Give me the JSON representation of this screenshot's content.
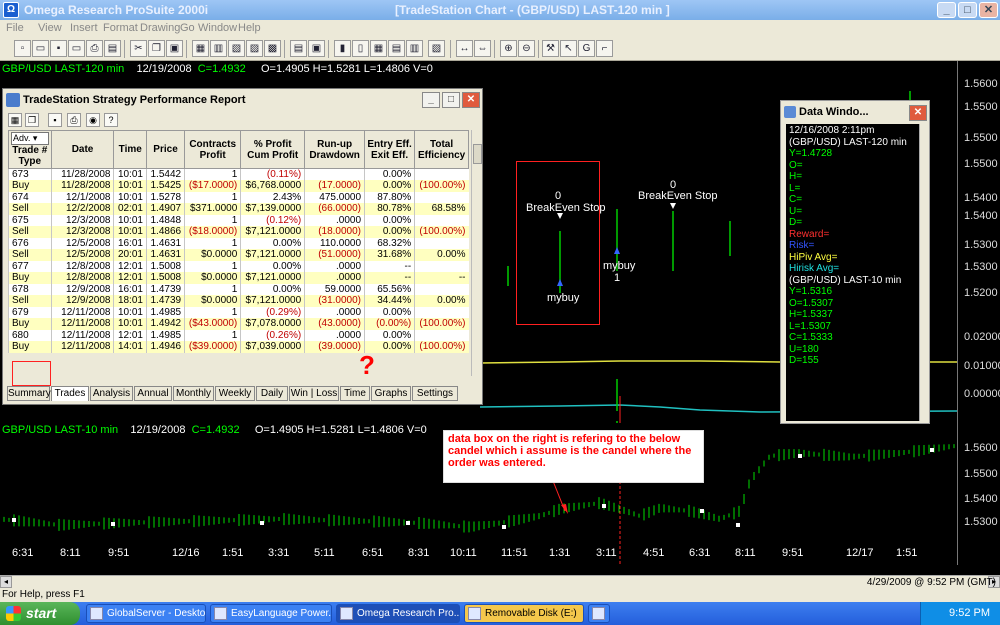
{
  "window": {
    "app_title": "Omega Research ProSuite 2000i",
    "chart_title": "[TradeStation Chart - (GBP/USD)  LAST-120 min ]",
    "minimize": "_",
    "maximize": "□",
    "close": "✕"
  },
  "menu": [
    "File",
    "View",
    "Insert",
    "Format",
    "Drawing",
    "Go",
    "Window",
    "Help"
  ],
  "chart": {
    "upper_header": {
      "symbol": "GBP/USD LAST-120 min",
      "date": "12/19/2008",
      "close": "C=1.4932",
      "ohlcv": "O=1.4905  H=1.5281  L=1.4806  V=0"
    },
    "lower_header": {
      "symbol": "GBP/USD LAST-10 min",
      "date": "12/19/2008",
      "close": "C=1.4932",
      "ohlcv": "O=1.4905  H=1.5281  L=1.4806  V=0"
    },
    "price_labels_upper": [
      "1.5600",
      "1.5500",
      "1.5400",
      "1.5300",
      "1.5200"
    ],
    "price_labels_mid": [
      "0.02000",
      "0.01000",
      "0.00000"
    ],
    "price_labels_lower": [
      "1.5600",
      "1.5500",
      "1.5400",
      "1.5300"
    ],
    "time_labels": [
      "6:31",
      "8:11",
      "9:51",
      "12/16",
      "1:51",
      "3:31",
      "5:11",
      "6:51",
      "8:31",
      "10:11",
      "11:51",
      "1:31",
      "3:11",
      "4:51",
      "6:31",
      "8:11",
      "9:51",
      "12/17",
      "1:51"
    ],
    "orders": [
      {
        "count": "0",
        "label": "BreakEven Stop"
      },
      {
        "count": "0",
        "label": "BreakEven Stop"
      }
    ],
    "mybuy_1": "mybuy",
    "mybuy_2": "mybuy",
    "mybuy_2_count": "1",
    "annotation": "data box on the right is refering to the below candel which i assume is the candel where the order was entered.",
    "question_mark": "?"
  },
  "colors": {
    "up": "#00ff00",
    "green_bar": "#00cc00",
    "blue": "#3366ff",
    "yellow_line": "#e0e040",
    "cyan_line": "#20c0c0",
    "red_line": "#ff2020"
  },
  "perf_report": {
    "title": "TradeStation Strategy Performance Report",
    "selector": "Adv.",
    "headers": [
      "Trade #\nType",
      "Date",
      "Time",
      "Price",
      "Contracts\nProfit",
      "% Profit\nCum Profit",
      "Run-up\nDrawdown",
      "Entry Eff.\nExit Eff.",
      "Total\nEfficiency"
    ],
    "rows": [
      {
        "kind": "entry",
        "cells": [
          "673",
          "11/28/2008",
          "10:01",
          "1.5442",
          "1",
          "(0.11%)",
          "",
          "0.00%",
          ""
        ],
        "neg": [
          5
        ]
      },
      {
        "kind": "buy",
        "cells": [
          "Buy",
          "11/28/2008",
          "10:01",
          "1.5425",
          "($17.0000)",
          "$6,768.0000",
          "(17.0000)",
          "0.00%",
          "(100.00%)"
        ],
        "neg": [
          4,
          6,
          8
        ]
      },
      {
        "kind": "entry",
        "cells": [
          "674",
          "12/1/2008",
          "10:01",
          "1.5278",
          "1",
          "2.43%",
          "475.0000",
          "87.80%",
          ""
        ],
        "neg": []
      },
      {
        "kind": "sell",
        "cells": [
          "Sell",
          "12/2/2008",
          "02:01",
          "1.4907",
          "$371.0000",
          "$7,139.0000",
          "(66.0000)",
          "80.78%",
          "68.58%"
        ],
        "neg": [
          6
        ]
      },
      {
        "kind": "entry",
        "cells": [
          "675",
          "12/3/2008",
          "10:01",
          "1.4848",
          "1",
          "(0.12%)",
          ".0000",
          "0.00%",
          ""
        ],
        "neg": [
          5
        ]
      },
      {
        "kind": "sell",
        "cells": [
          "Sell",
          "12/3/2008",
          "10:01",
          "1.4866",
          "($18.0000)",
          "$7,121.0000",
          "(18.0000)",
          "0.00%",
          "(100.00%)"
        ],
        "neg": [
          4,
          6,
          8
        ]
      },
      {
        "kind": "entry",
        "cells": [
          "676",
          "12/5/2008",
          "16:01",
          "1.4631",
          "1",
          "0.00%",
          "110.0000",
          "68.32%",
          ""
        ],
        "neg": []
      },
      {
        "kind": "sell",
        "cells": [
          "Sell",
          "12/5/2008",
          "20:01",
          "1.4631",
          "$0.0000",
          "$7,121.0000",
          "(51.0000)",
          "31.68%",
          "0.00%"
        ],
        "neg": [
          6
        ]
      },
      {
        "kind": "entry",
        "cells": [
          "677",
          "12/8/2008",
          "12:01",
          "1.5008",
          "1",
          "0.00%",
          ".0000",
          "--",
          ""
        ],
        "neg": []
      },
      {
        "kind": "buy",
        "cells": [
          "Buy",
          "12/8/2008",
          "12:01",
          "1.5008",
          "$0.0000",
          "$7,121.0000",
          ".0000",
          "--",
          "--"
        ],
        "neg": []
      },
      {
        "kind": "entry",
        "cells": [
          "678",
          "12/9/2008",
          "16:01",
          "1.4739",
          "1",
          "0.00%",
          "59.0000",
          "65.56%",
          ""
        ],
        "neg": []
      },
      {
        "kind": "sell",
        "cells": [
          "Sell",
          "12/9/2008",
          "18:01",
          "1.4739",
          "$0.0000",
          "$7,121.0000",
          "(31.0000)",
          "34.44%",
          "0.00%"
        ],
        "neg": [
          6
        ]
      },
      {
        "kind": "entry",
        "cells": [
          "679",
          "12/11/2008",
          "10:01",
          "1.4985",
          "1",
          "(0.29%)",
          ".0000",
          "0.00%",
          ""
        ],
        "neg": [
          5
        ]
      },
      {
        "kind": "buy",
        "cells": [
          "Buy",
          "12/11/2008",
          "10:01",
          "1.4942",
          "($43.0000)",
          "$7,078.0000",
          "(43.0000)",
          "(0.00%)",
          "(100.00%)"
        ],
        "neg": [
          4,
          6,
          7,
          8
        ]
      },
      {
        "kind": "entry",
        "cells": [
          "680",
          "12/11/2008",
          "12:01",
          "1.4985",
          "1",
          "(0.26%)",
          ".0000",
          "0.00%",
          ""
        ],
        "neg": [
          5
        ]
      },
      {
        "kind": "buy",
        "cells": [
          "Buy",
          "12/11/2008",
          "14:01",
          "1.4946",
          "($39.0000)",
          "$7,039.0000",
          "(39.0000)",
          "0.00%",
          "(100.00%)"
        ],
        "neg": [
          4,
          6,
          8
        ]
      }
    ],
    "tabs": [
      "Summary",
      "Trades",
      "Analysis",
      "Annual",
      "Monthly",
      "Weekly",
      "Daily",
      "Win | Loss",
      "Time",
      "Graphs",
      "Settings"
    ],
    "active_tab": "Trades"
  },
  "data_window": {
    "title": "Data Windo...",
    "lines": [
      {
        "t": "12/16/2008  2:11pm",
        "c": "#ffffff"
      },
      {
        "t": "(GBP/USD)  LAST-120 min",
        "c": "#ffffff"
      },
      {
        "t": "Y=1.4728",
        "c": "#00ff00"
      },
      {
        "t": "O=",
        "c": "#00ff00"
      },
      {
        "t": "H=",
        "c": "#00ff00"
      },
      {
        "t": "L=",
        "c": "#00ff00"
      },
      {
        "t": "C=",
        "c": "#00ff00"
      },
      {
        "t": "U=",
        "c": "#00ff00"
      },
      {
        "t": "D=",
        "c": "#00ff00"
      },
      {
        "t": "Reward=",
        "c": "#ff3030"
      },
      {
        "t": "Risk=",
        "c": "#3355ff"
      },
      {
        "t": "HiPiv Avg=",
        "c": "#ffff40"
      },
      {
        "t": "Hirisk Avg=",
        "c": "#20e0e0"
      },
      {
        "t": "(GBP/USD)  LAST-10 min",
        "c": "#ffffff"
      },
      {
        "t": "Y=1.5316",
        "c": "#00ff00"
      },
      {
        "t": "O=1.5307",
        "c": "#00ff00"
      },
      {
        "t": "H=1.5337",
        "c": "#00ff00"
      },
      {
        "t": "L=1.5307",
        "c": "#00ff00"
      },
      {
        "t": "C=1.5333",
        "c": "#00ff00"
      },
      {
        "t": "U=180",
        "c": "#00ff00"
      },
      {
        "t": "D=155",
        "c": "#00ff00"
      }
    ]
  },
  "status": {
    "help": "For Help, press F1",
    "timestamp": "4/29/2009 @ 9:52 PM (GMT)"
  },
  "taskbar": {
    "start": "start",
    "tasks": [
      "GlobalServer - Deskto...",
      "EasyLanguage Power...",
      "Omega Research Pro...",
      "Removable Disk (E:)"
    ],
    "clock": "9:52 PM"
  }
}
